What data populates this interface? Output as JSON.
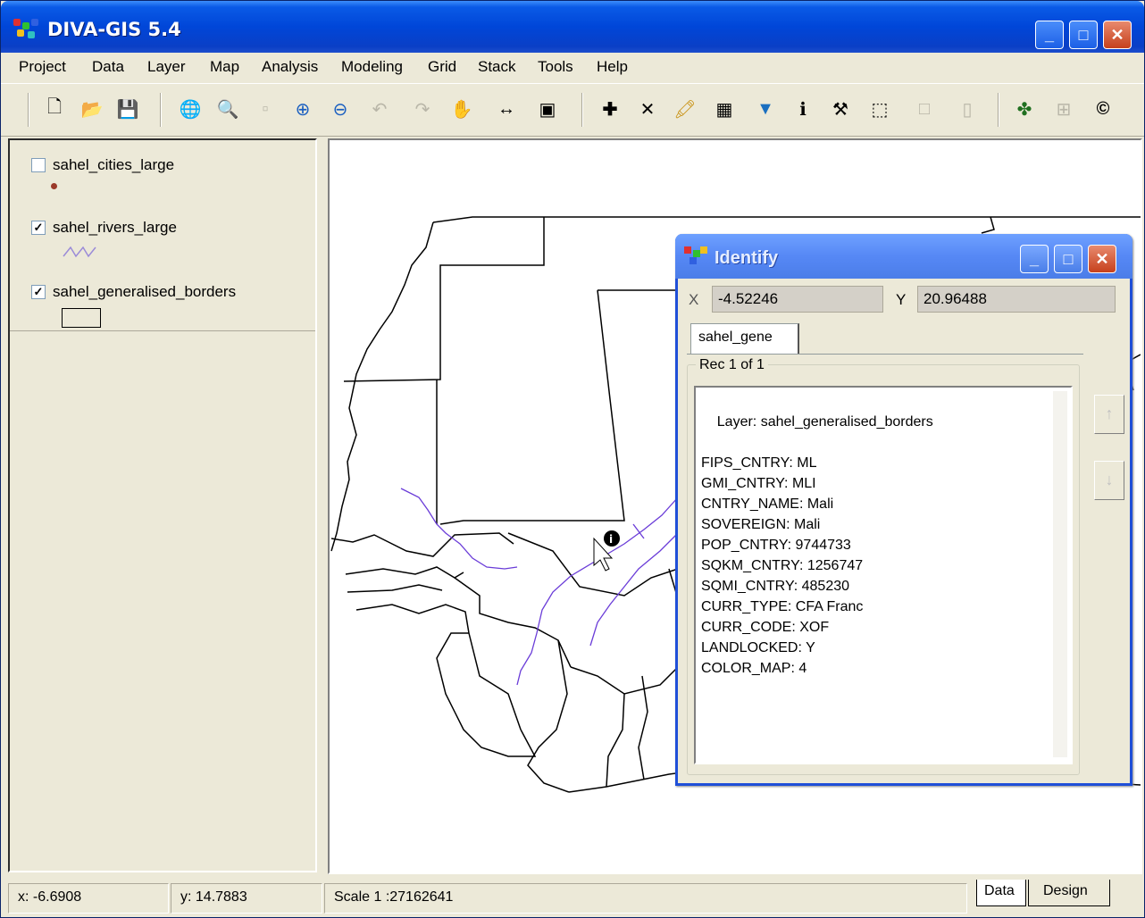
{
  "window": {
    "title": "DIVA-GIS 5.4"
  },
  "menu": [
    "Project",
    "Data",
    "Layer",
    "Map",
    "Analysis",
    "Modeling",
    "Grid",
    "Stack",
    "Tools",
    "Help"
  ],
  "toolbar": {
    "tools": [
      {
        "name": "new-icon",
        "glyph": "🗋"
      },
      {
        "name": "open-icon",
        "glyph": "📂"
      },
      {
        "name": "save-icon",
        "glyph": "💾"
      },
      {
        "name": "full-extent-icon",
        "glyph": "🌐"
      },
      {
        "name": "zoom-layer-icon",
        "glyph": "🔍"
      },
      {
        "name": "zoom-selected-icon",
        "glyph": "▫"
      },
      {
        "name": "zoom-in-icon",
        "glyph": "⊕"
      },
      {
        "name": "zoom-out-icon",
        "glyph": "⊖"
      },
      {
        "name": "previous-extent-icon",
        "glyph": "↶"
      },
      {
        "name": "next-extent-icon",
        "glyph": "↷"
      },
      {
        "name": "pan-icon",
        "glyph": "✋"
      },
      {
        "name": "measure-icon",
        "glyph": "↔"
      },
      {
        "name": "copy-map-icon",
        "glyph": "▣"
      },
      {
        "name": "add-point-icon",
        "glyph": "✚"
      },
      {
        "name": "delete-icon",
        "glyph": "✕"
      },
      {
        "name": "draw-icon",
        "glyph": "🖍"
      },
      {
        "name": "table-icon",
        "glyph": "▦"
      },
      {
        "name": "query-icon",
        "glyph": "▼"
      },
      {
        "name": "identify-icon",
        "glyph": "ℹ"
      },
      {
        "name": "tools-icon",
        "glyph": "⚒"
      },
      {
        "name": "select-icon",
        "glyph": "⬚"
      },
      {
        "name": "clear-selection-icon",
        "glyph": "□"
      },
      {
        "name": "delete-selection-icon",
        "glyph": "▯"
      },
      {
        "name": "layer-color-icon",
        "glyph": "✤"
      },
      {
        "name": "grid-icon",
        "glyph": "⊞"
      },
      {
        "name": "copyright-icon",
        "glyph": "©"
      }
    ]
  },
  "legend": {
    "layers": [
      {
        "name": "sahel_cities_large",
        "checked": false,
        "symbol": "point"
      },
      {
        "name": "sahel_rivers_large",
        "checked": true,
        "symbol": "line"
      },
      {
        "name": "sahel_generalised_borders",
        "checked": true,
        "symbol": "polygon"
      }
    ]
  },
  "identify": {
    "title": "Identify",
    "x_label": "X",
    "x_value": "-4.52246",
    "y_label": "Y",
    "y_value": "20.96488",
    "tab": "sahel_gene",
    "record_group": "Rec 1 of 1",
    "record_text": "Layer: sahel_generalised_borders\n\nFIPS_CNTRY: ML\nGMI_CNTRY: MLI\nCNTRY_NAME: Mali\nSOVEREIGN: Mali\nPOP_CNTRY: 9744733\nSQKM_CNTRY: 1256747\nSQMI_CNTRY: 485230\nCURR_TYPE: CFA Franc\nCURR_CODE: XOF\nLANDLOCKED: Y\nCOLOR_MAP: 4"
  },
  "status": {
    "x": "x: -6.6908",
    "y": "y: 14.7883",
    "scale": "Scale 1 :27162641"
  },
  "tabs": [
    "Data",
    "Design"
  ],
  "colors": {
    "titlebar": "#0046d8",
    "river": "#6a3cd8",
    "border": "#000000"
  }
}
